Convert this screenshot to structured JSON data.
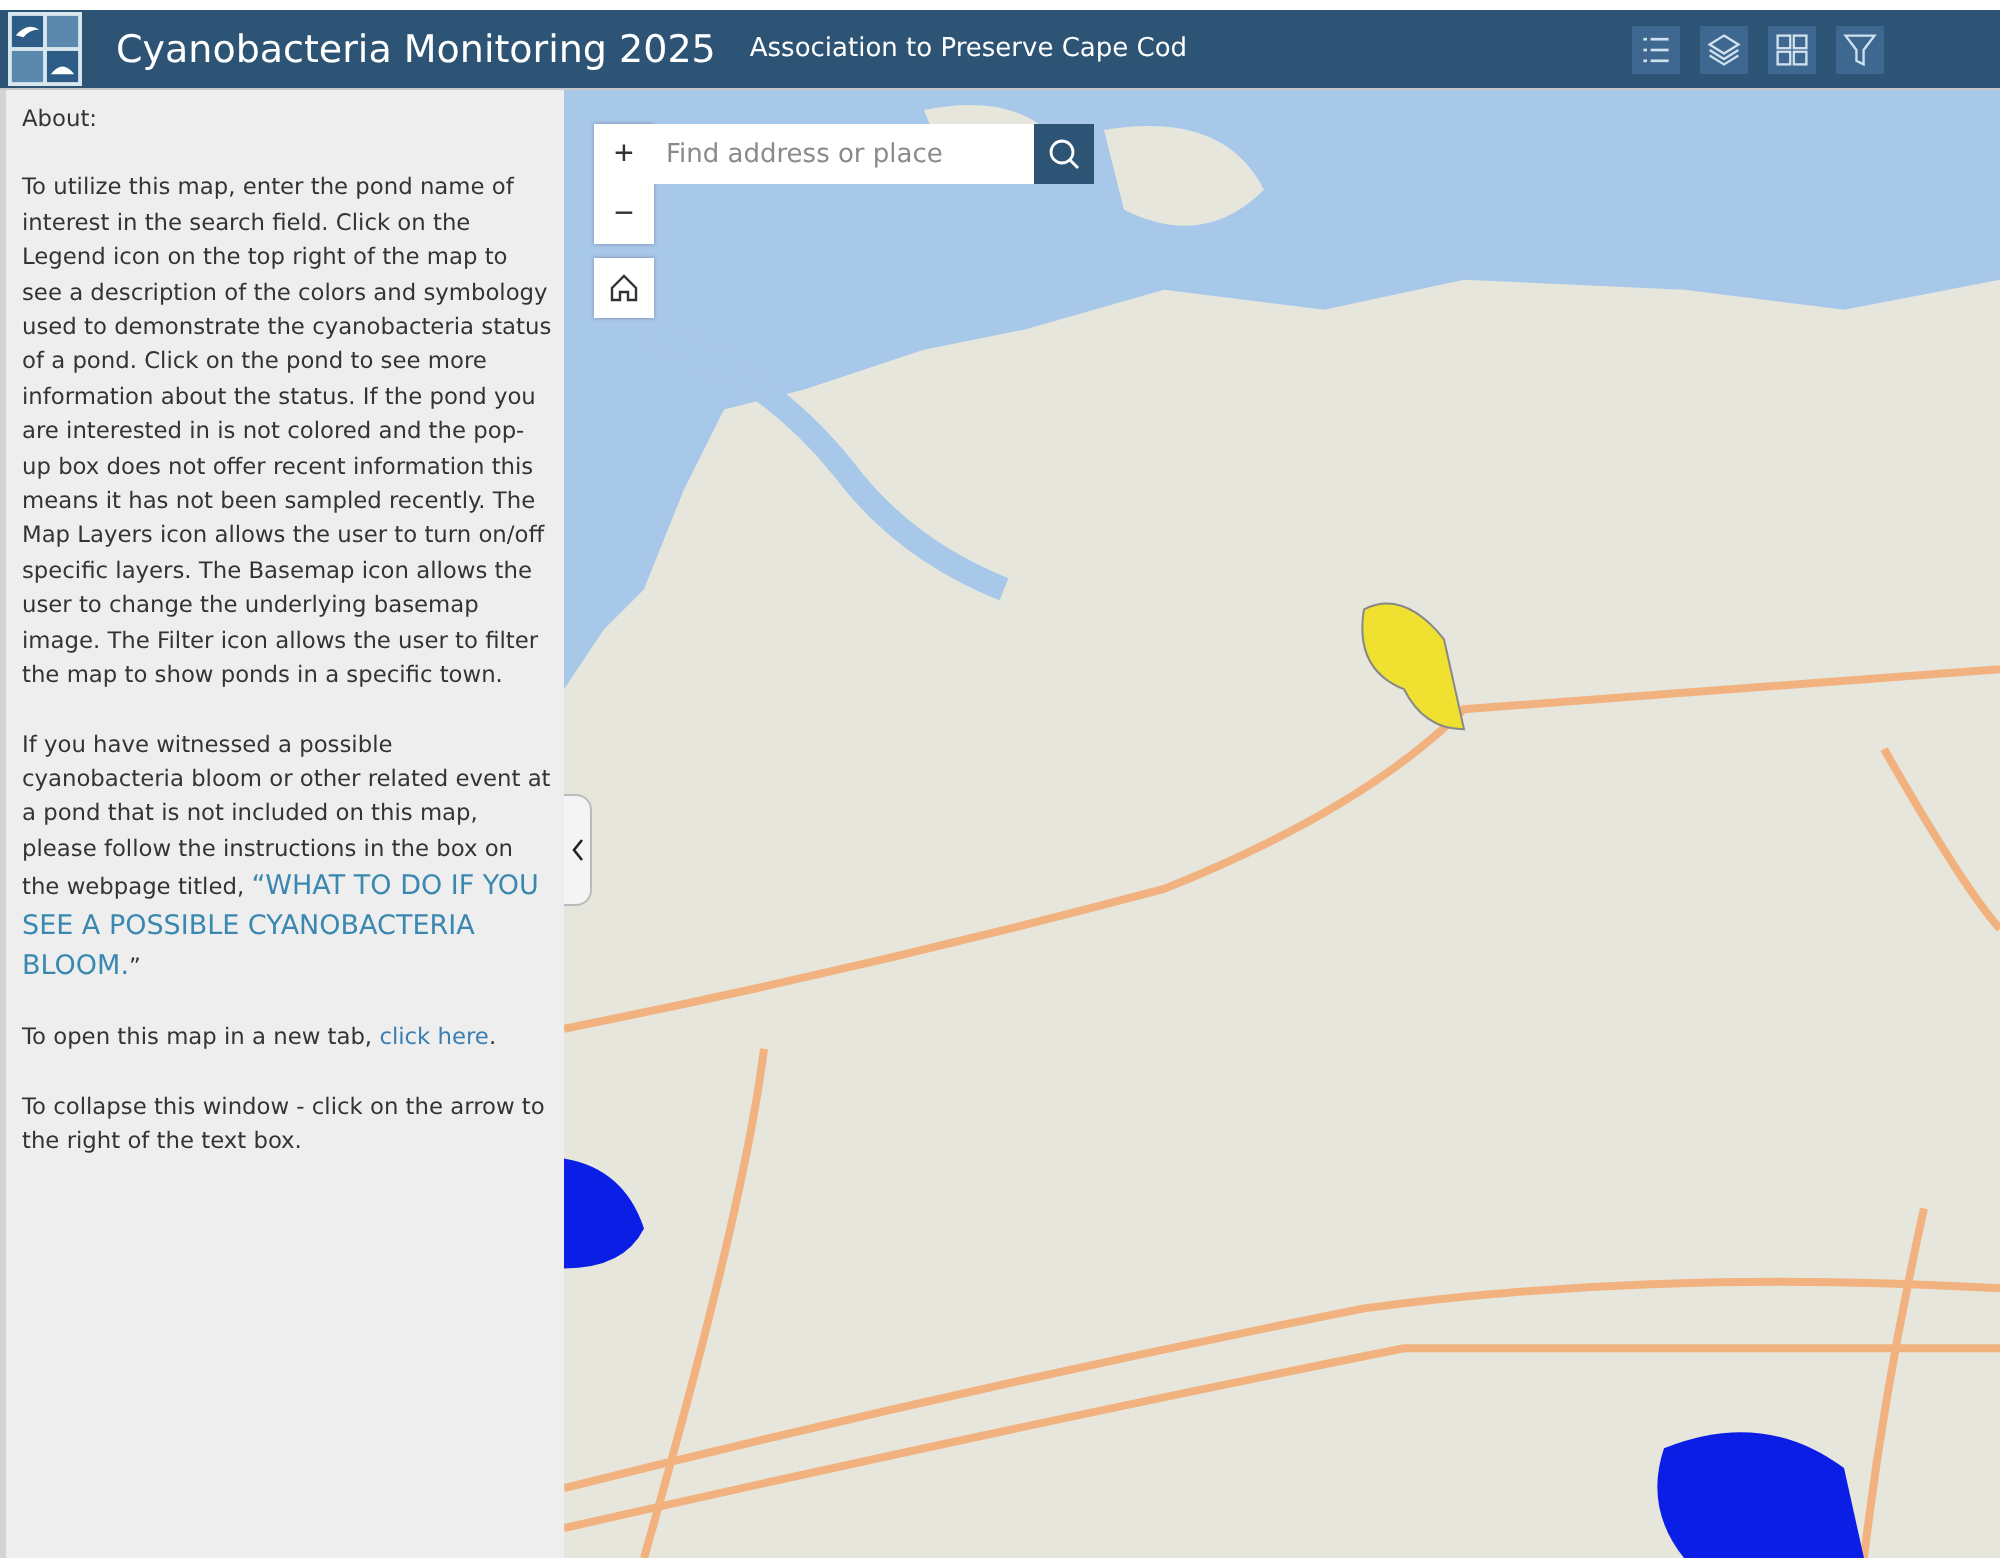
{
  "header": {
    "title": "Cyanobacteria Monitoring 2025",
    "subtitle": "Association to Preserve Cape Cod",
    "tools": [
      {
        "kind": "legend",
        "selected": false
      },
      {
        "kind": "layers",
        "selected": false
      },
      {
        "kind": "basemap",
        "selected": false
      },
      {
        "kind": "filter",
        "selected": false
      }
    ]
  },
  "sidebar": {
    "heading": "About:",
    "paragraphs": [
      {
        "text": "To utilize this map, enter the pond name of interest in the search field. Click on the Legend icon on the top right of the map to see a description of the colors and symbology used to demonstrate the cyanobacteria status of a pond. Click on the pond to see more information about the status. If the pond you are interested in is not colored and the pop-up box does not offer recent information this means it has not been sampled recently. The Map Layers icon allows the user to turn on/off specific layers. The Basemap icon allows the user to change the underlying basemap image. The Filter icon allows the user to filter the map to show ponds in a specific town."
      },
      {
        "text": "If you have witnessed a possible cyanobacteria bloom or other related event at a pond that is not included on this map, please follow the instructions in the box on the webpage titled, ",
        "highlight": "“WHAT TO DO IF YOU SEE A POSSIBLE CYANOBACTERIA BLOOM.",
        "after": "”"
      },
      {
        "text": "To open this map in a new tab, ",
        "link": "click here",
        "after": "."
      },
      {
        "text": "To collapse this window - click on the arrow to the right of the text box."
      }
    ]
  },
  "map": {
    "zoom_in": "+",
    "zoom_out": "−",
    "search": {
      "placeholder": "Find address or place"
    }
  }
}
